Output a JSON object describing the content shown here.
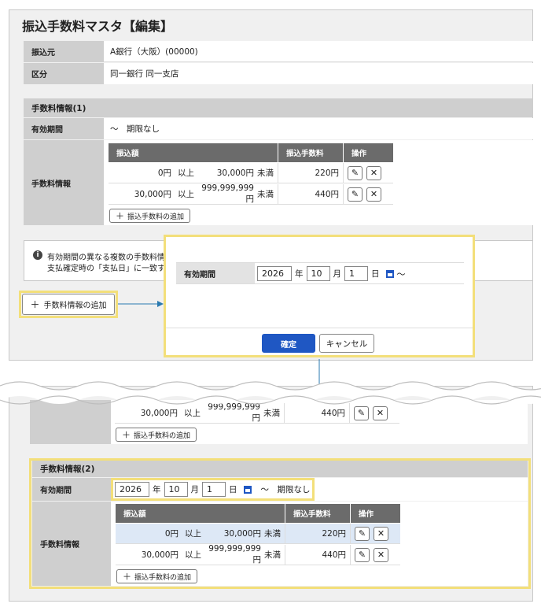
{
  "title": "振込手数料マスタ【編集】",
  "transfer_source": {
    "label": "振込元",
    "value": "A銀行（大阪）(00000)"
  },
  "category": {
    "label": "区分",
    "value": "同一銀行 同一支店"
  },
  "fee_info_1": {
    "header": "手数料情報(1)",
    "period_label": "有効期間",
    "period_value": "～　期限なし",
    "info_label": "手数料情報",
    "columns": [
      "振込額",
      "振込手数料",
      "操作"
    ],
    "rows": [
      {
        "from": "0円",
        "from_op": "以上",
        "to": "30,000円",
        "to_op": "未満",
        "fee": "220円"
      },
      {
        "from": "30,000円",
        "from_op": "以上",
        "to": "999,999,999円",
        "to_op": "未満",
        "fee": "440円"
      }
    ],
    "add_fee_label": "振込手数料の追加"
  },
  "notice": {
    "line1": "有効期間の異なる複数の手数料情",
    "line2": "支払確定時の「支払日」に一致す"
  },
  "add_fee_info_label": "手数料情報の追加",
  "modal": {
    "period_label": "有効期間",
    "year": "2026",
    "year_unit": "年",
    "month": "10",
    "month_unit": "月",
    "day": "1",
    "day_unit": "日",
    "tilde": "～",
    "confirm_label": "確定",
    "cancel_label": "キャンセル"
  },
  "lower": {
    "row_partial": {
      "from": "30,000円",
      "from_op": "以上",
      "to": "999,999,999円",
      "to_op": "未満",
      "fee": "440円"
    },
    "add_fee_label": "振込手数料の追加",
    "fee_info_2": {
      "header": "手数料情報(2)",
      "period_label": "有効期間",
      "year": "2026",
      "year_unit": "年",
      "month": "10",
      "month_unit": "月",
      "day": "1",
      "day_unit": "日",
      "period_suffix": "～　期限なし",
      "info_label": "手数料情報",
      "columns": [
        "振込額",
        "振込手数料",
        "操作"
      ],
      "rows": [
        {
          "from": "0円",
          "from_op": "以上",
          "to": "30,000円",
          "to_op": "未満",
          "fee": "220円"
        },
        {
          "from": "30,000円",
          "from_op": "以上",
          "to": "999,999,999円",
          "to_op": "未満",
          "fee": "440円"
        }
      ],
      "add_fee_label": "振込手数料の追加"
    }
  },
  "icons": {
    "edit": "pencil-icon",
    "delete": "close-icon",
    "calendar": "calendar-icon",
    "info": "info-icon",
    "plus": "plus-icon"
  },
  "colors": {
    "primary": "#1f57c3",
    "highlight": "#f3df7a",
    "arrow": "#2a7ab0",
    "row_highlight": "#dde8f6"
  }
}
